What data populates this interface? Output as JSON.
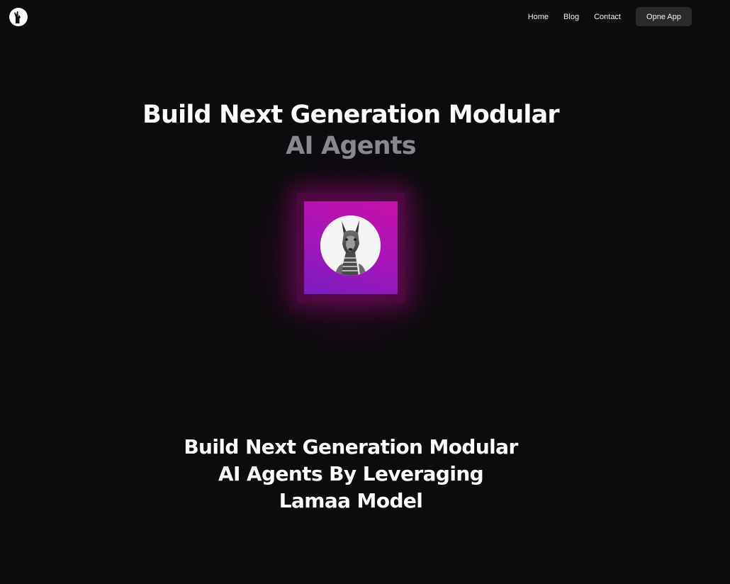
{
  "nav": {
    "logo_icon": "llama-logo-icon",
    "links": [
      {
        "label": "Home"
      },
      {
        "label": "Blog"
      },
      {
        "label": "Contact"
      }
    ],
    "cta_label": "Opne App"
  },
  "hero": {
    "title_line1": "Build Next Generation Modular",
    "title_line2": "AI Agents",
    "image_icon": "llama-avatar",
    "accent_colors": [
      "#7a1cc0",
      "#c511a8"
    ]
  },
  "tagline": {
    "lines": [
      "Build Next Generation Modular",
      "AI Agents By Leveraging",
      "Lamaa Model"
    ]
  }
}
